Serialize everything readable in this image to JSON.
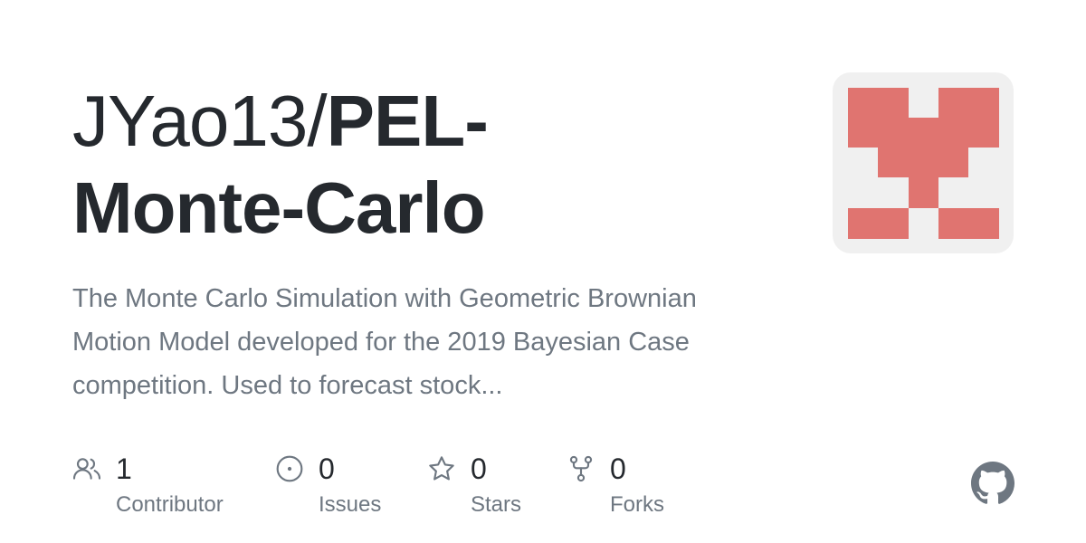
{
  "repo": {
    "owner": "JYao13/",
    "name_part1": "PEL-",
    "name_part2": "Monte-Carlo",
    "description": "The Monte Carlo Simulation with Geometric Brownian Motion Model developed for the 2019 Bayesian Case competition. Used to forecast stock..."
  },
  "stats": {
    "contributors": {
      "count": "1",
      "label": "Contributor",
      "icon": "people-icon"
    },
    "issues": {
      "count": "0",
      "label": "Issues",
      "icon": "issue-opened-icon"
    },
    "stars": {
      "count": "0",
      "label": "Stars",
      "icon": "star-icon"
    },
    "forks": {
      "count": "0",
      "label": "Forks",
      "icon": "repo-forked-icon"
    }
  },
  "avatar": {
    "icon": "identicon",
    "color": "#e07470",
    "background": "#f0f0f0"
  },
  "brand": {
    "icon": "github-mark-icon",
    "color": "#6e7781"
  }
}
